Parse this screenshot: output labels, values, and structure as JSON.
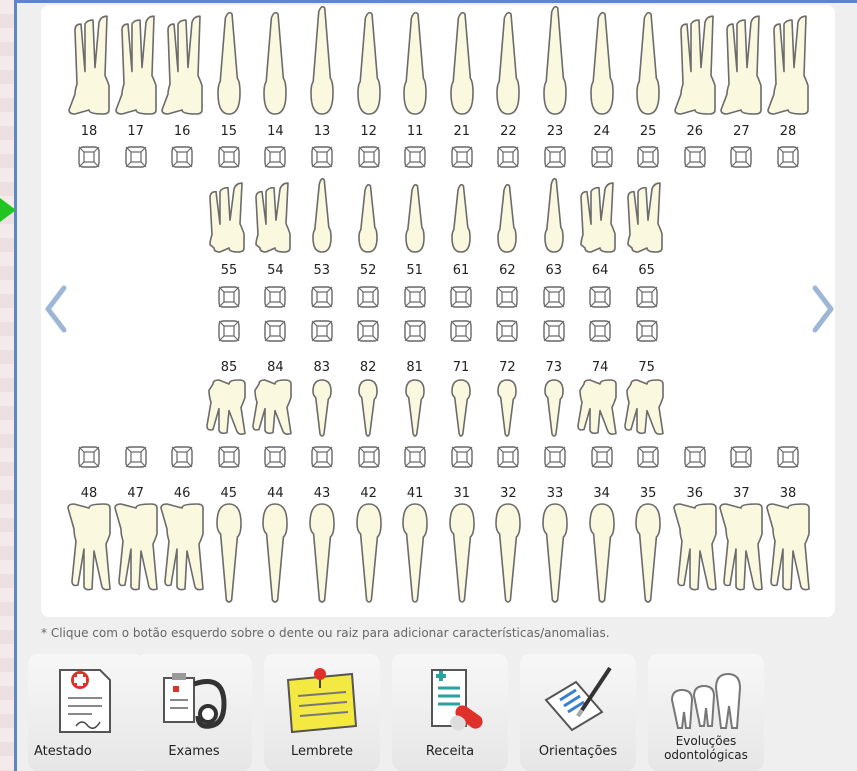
{
  "permanent_upper": [
    "18",
    "17",
    "16",
    "15",
    "14",
    "13",
    "12",
    "11",
    "21",
    "22",
    "23",
    "24",
    "25",
    "26",
    "27",
    "28"
  ],
  "deciduous_upper": [
    "55",
    "54",
    "53",
    "52",
    "51",
    "61",
    "62",
    "63",
    "64",
    "65"
  ],
  "deciduous_lower": [
    "85",
    "84",
    "83",
    "82",
    "81",
    "71",
    "72",
    "73",
    "74",
    "75"
  ],
  "permanent_lower": [
    "48",
    "47",
    "46",
    "45",
    "44",
    "43",
    "42",
    "41",
    "31",
    "32",
    "33",
    "34",
    "35",
    "36",
    "37",
    "38"
  ],
  "nav": {
    "prev_icon": "chevron-left-icon",
    "next_icon": "chevron-right-icon"
  },
  "note": "* Clique com o botão esquerdo sobre o dente ou raiz para adicionar características/anomalias.",
  "toolbar": [
    {
      "label": "Atestado",
      "icon": "certificate-icon"
    },
    {
      "label": "Exames",
      "icon": "stethoscope-icon"
    },
    {
      "label": "Lembrete",
      "icon": "pinned-note-icon"
    },
    {
      "label": "Receita",
      "icon": "prescription-pills-icon"
    },
    {
      "label": "Orientações",
      "icon": "pen-document-icon"
    },
    {
      "label": "Evoluções odontológicas",
      "icon": "teeth-icon"
    }
  ],
  "colors": {
    "accent": "#5b87c8",
    "tooth_fill": "#fbf8e0",
    "tooth_stroke": "#6b6b6b",
    "marker": "#22c422"
  }
}
